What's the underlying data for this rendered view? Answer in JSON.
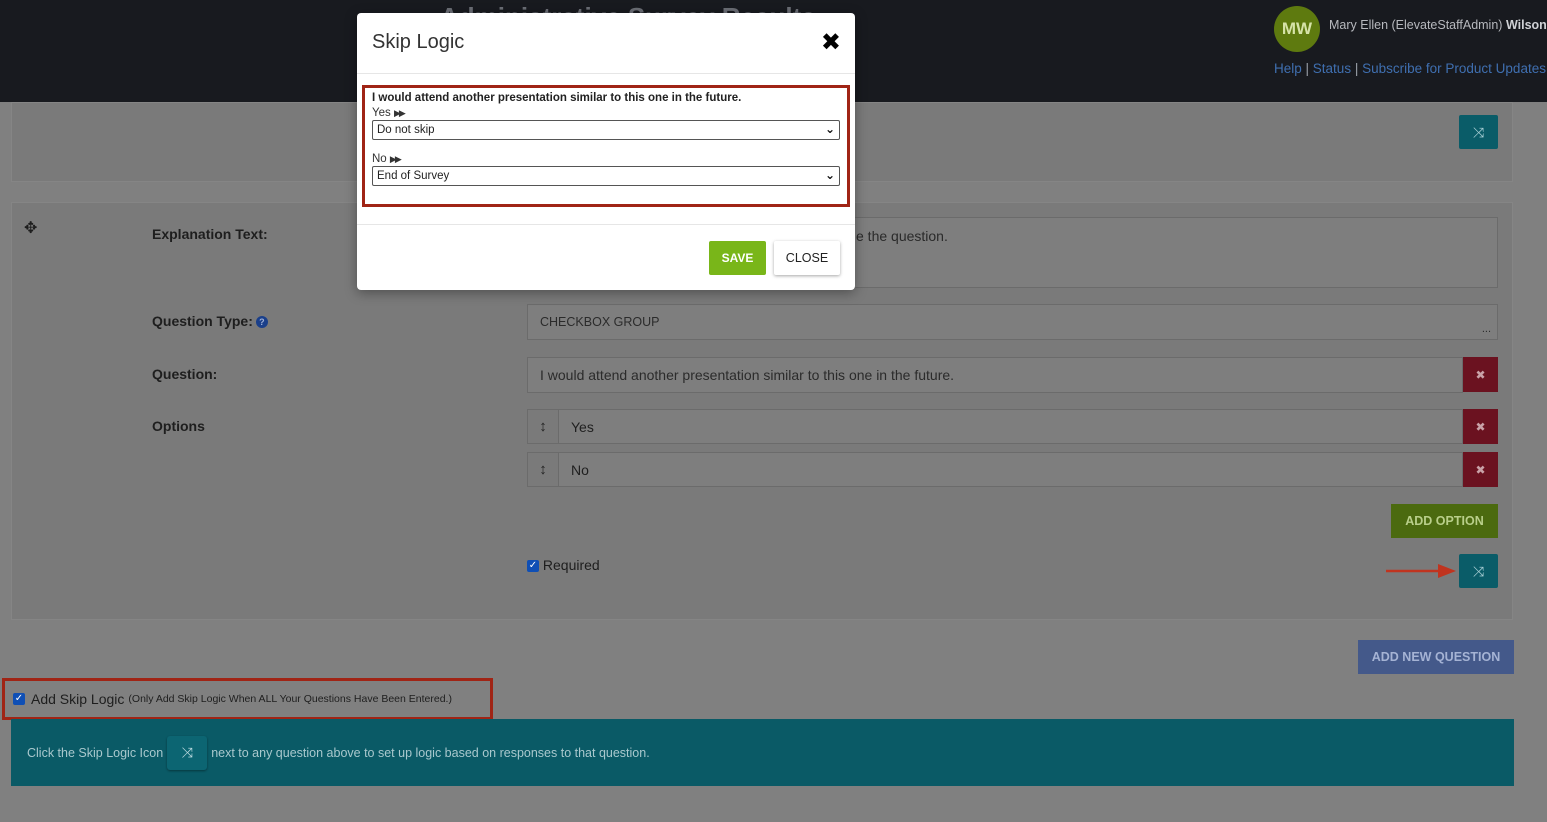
{
  "header": {
    "title_partial": "Administrative Survey Results",
    "user": {
      "initials": "MW",
      "name_prefix": "Mary Ellen (ElevateStaffAdmin)",
      "name_last": "Wilson"
    },
    "links": [
      "Help",
      "Status",
      "Subscribe for Product Updates"
    ]
  },
  "question_editor": {
    "explanation_label": "Explanation Text:",
    "explanation_placeholder": "e the question.",
    "question_type_label": "Question Type:",
    "question_type_value": "CHECKBOX GROUP",
    "question_type_more": "...",
    "question_label": "Question:",
    "question_value": "I would attend another presentation similar to this one in the future.",
    "options_label": "Options",
    "options": [
      "Yes",
      "No"
    ],
    "add_option_label": "ADD OPTION",
    "required_label": "Required",
    "required_checked": true
  },
  "add_new_question_label": "ADD NEW QUESTION",
  "skip_logic_toggle": {
    "label": "Add Skip Logic",
    "note": "(Only Add Skip Logic When ALL Your Questions Have Been Entered.)",
    "checked": true
  },
  "info_bar": {
    "text_before": "Click the Skip Logic Icon",
    "text_after": "next to any question above to set up logic based on responses to that question."
  },
  "modal": {
    "title": "Skip Logic",
    "question": "I would attend another presentation similar to this one in the future.",
    "rules": [
      {
        "option": "Yes",
        "selected": "Do not skip"
      },
      {
        "option": "No",
        "selected": "End of Survey"
      }
    ],
    "save_label": "SAVE",
    "close_label": "CLOSE"
  },
  "colors": {
    "accent_green": "#79b619",
    "annotation_red": "#a02415",
    "teal": "#11a6b8",
    "delete_red": "#d0243c"
  },
  "icons": {
    "close": "close-icon",
    "shuffle": "shuffle-icon",
    "move": "move-icon",
    "sort": "sort-handle-icon",
    "delete": "delete-x-icon",
    "help": "help-icon",
    "fast_forward": "fast-forward-icon",
    "chevron": "chevron-down-icon"
  }
}
